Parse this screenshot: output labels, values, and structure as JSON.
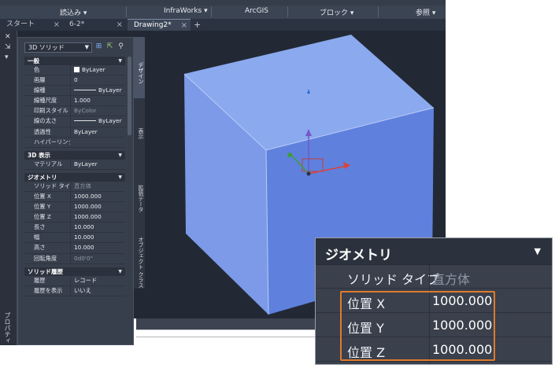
{
  "ribbon": {
    "panels": [
      "読込み",
      "InfraWorks",
      "ArcGIS",
      "ブロック",
      "参照"
    ]
  },
  "tabs": [
    {
      "label": "スタート",
      "active": false
    },
    {
      "label": "6-2*",
      "active": false
    },
    {
      "label": "Drawing2*",
      "active": true
    }
  ],
  "palette": {
    "object_type": "3D ソリッド",
    "sections": [
      {
        "title": "一般",
        "rows": [
          {
            "key": "色",
            "value": "ByLayer",
            "swatch": true
          },
          {
            "key": "画層",
            "value": "0"
          },
          {
            "key": "線種",
            "value": "ByLayer",
            "line": true
          },
          {
            "key": "線種尺度",
            "value": "1.000"
          },
          {
            "key": "印刷スタイル",
            "value": "ByColor",
            "dim": true
          },
          {
            "key": "線の太さ",
            "value": "ByLayer",
            "line": true
          },
          {
            "key": "透過性",
            "value": "ByLayer"
          },
          {
            "key": "ハイパーリンク",
            "value": ""
          }
        ]
      },
      {
        "title": "3D 表示",
        "rows": [
          {
            "key": "マテリアル",
            "value": "ByLayer"
          }
        ]
      },
      {
        "title": "ジオメトリ",
        "rows": [
          {
            "key": "ソリッド タイプ",
            "value": "直方体",
            "dim": true
          },
          {
            "key": "位置 X",
            "value": "1000.000"
          },
          {
            "key": "位置 Y",
            "value": "1000.000"
          },
          {
            "key": "位置 Z",
            "value": "1000.000"
          },
          {
            "key": "長さ",
            "value": "10.000"
          },
          {
            "key": "幅",
            "value": "10.000"
          },
          {
            "key": "高さ",
            "value": "10.000"
          },
          {
            "key": "回転角度",
            "value": "0d0'0\"",
            "dim": true
          }
        ]
      },
      {
        "title": "ソリッド履歴",
        "rows": [
          {
            "key": "履歴",
            "value": "レコード"
          },
          {
            "key": "履歴を表示",
            "value": "いいえ"
          }
        ]
      }
    ],
    "side_tabs": [
      "デザイン",
      "表示",
      "拡張データ",
      "オブジェクト クラス"
    ],
    "vertical_title": "プロパティ"
  },
  "zoom": {
    "title": "ジオメトリ",
    "rows": [
      {
        "key": "ソリッド タイプ",
        "value": "直方体",
        "dim": true
      },
      {
        "key": "位置 X",
        "value": "1000.000"
      },
      {
        "key": "位置 Y",
        "value": "1000.000"
      },
      {
        "key": "位置 Z",
        "value": "1000.000"
      }
    ]
  },
  "colors": {
    "cube_top": "#8ba9ee",
    "cube_left": "#7c9ae8",
    "cube_right": "#5f81dd",
    "highlight": "#e07b2c"
  }
}
